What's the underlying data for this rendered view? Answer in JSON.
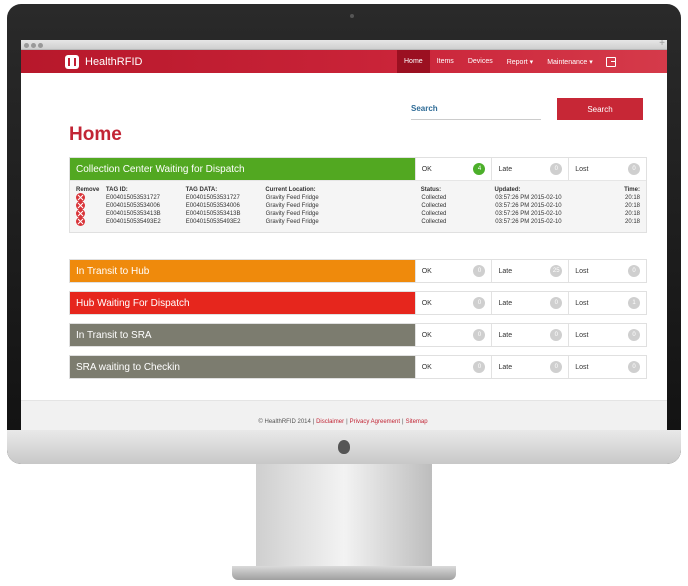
{
  "brand": {
    "name": "HealthRFID"
  },
  "nav": {
    "home": "Home",
    "items": "Items",
    "devices": "Devices",
    "report": "Report ▾",
    "maintenance": "Maintenance ▾"
  },
  "search": {
    "placeholder": "Search",
    "button": "Search"
  },
  "page_title": "Home",
  "panels": [
    {
      "title": "Collection Center Waiting for Dispatch",
      "color": "#52a821",
      "ok_label": "OK",
      "ok": "4",
      "late_label": "Late",
      "late": "0",
      "lost_label": "Lost",
      "lost": "0",
      "table": {
        "headers": [
          "Remove",
          "TAG ID:",
          "TAG DATA:",
          "Current Location:",
          "Status:",
          "Updated:",
          "Time:"
        ],
        "rows": [
          {
            "tag_id": "E004015053531727",
            "tag_data": "E004015053531727",
            "location": "Gravity Feed Fridge",
            "status": "Collected",
            "updated": "03:57:26 PM 2015-02-10",
            "time": "20:18"
          },
          {
            "tag_id": "E004015053534006",
            "tag_data": "E004015053534006",
            "location": "Gravity Feed Fridge",
            "status": "Collected",
            "updated": "03:57:26 PM 2015-02-10",
            "time": "20:18"
          },
          {
            "tag_id": "E00401505353413B",
            "tag_data": "E00401505353413B",
            "location": "Gravity Feed Fridge",
            "status": "Collected",
            "updated": "03:57:26 PM 2015-02-10",
            "time": "20:18"
          },
          {
            "tag_id": "E0040150535493E2",
            "tag_data": "E0040150535493E2",
            "location": "Gravity Feed Fridge",
            "status": "Collected",
            "updated": "03:57:26 PM 2015-02-10",
            "time": "20:18"
          }
        ]
      }
    },
    {
      "title": "In Transit to Hub",
      "color": "#ef8a0c",
      "ok_label": "OK",
      "ok": "0",
      "late_label": "Late",
      "late": "25",
      "lost_label": "Lost",
      "lost": "0"
    },
    {
      "title": "Hub Waiting For Dispatch",
      "color": "#e6261d",
      "ok_label": "OK",
      "ok": "0",
      "late_label": "Late",
      "late": "0",
      "lost_label": "Lost",
      "lost": "1"
    },
    {
      "title": "In Transit to SRA",
      "color": "#7c7c6f",
      "ok_label": "OK",
      "ok": "0",
      "late_label": "Late",
      "late": "0",
      "lost_label": "Lost",
      "lost": "0"
    },
    {
      "title": "SRA waiting to Checkin",
      "color": "#7c7c6f",
      "ok_label": "OK",
      "ok": "0",
      "late_label": "Late",
      "late": "0",
      "lost_label": "Lost",
      "lost": "0"
    }
  ],
  "footer": {
    "copyright": "© HealthRFID 2014 |",
    "disclaimer": "Disclaimer",
    "sep1": "|",
    "privacy": "Privacy Agreement",
    "sep2": "|",
    "sitemap": "Sitemap"
  },
  "colors": {
    "brand_red": "#c72736",
    "badge_green": "#4caf2a"
  }
}
